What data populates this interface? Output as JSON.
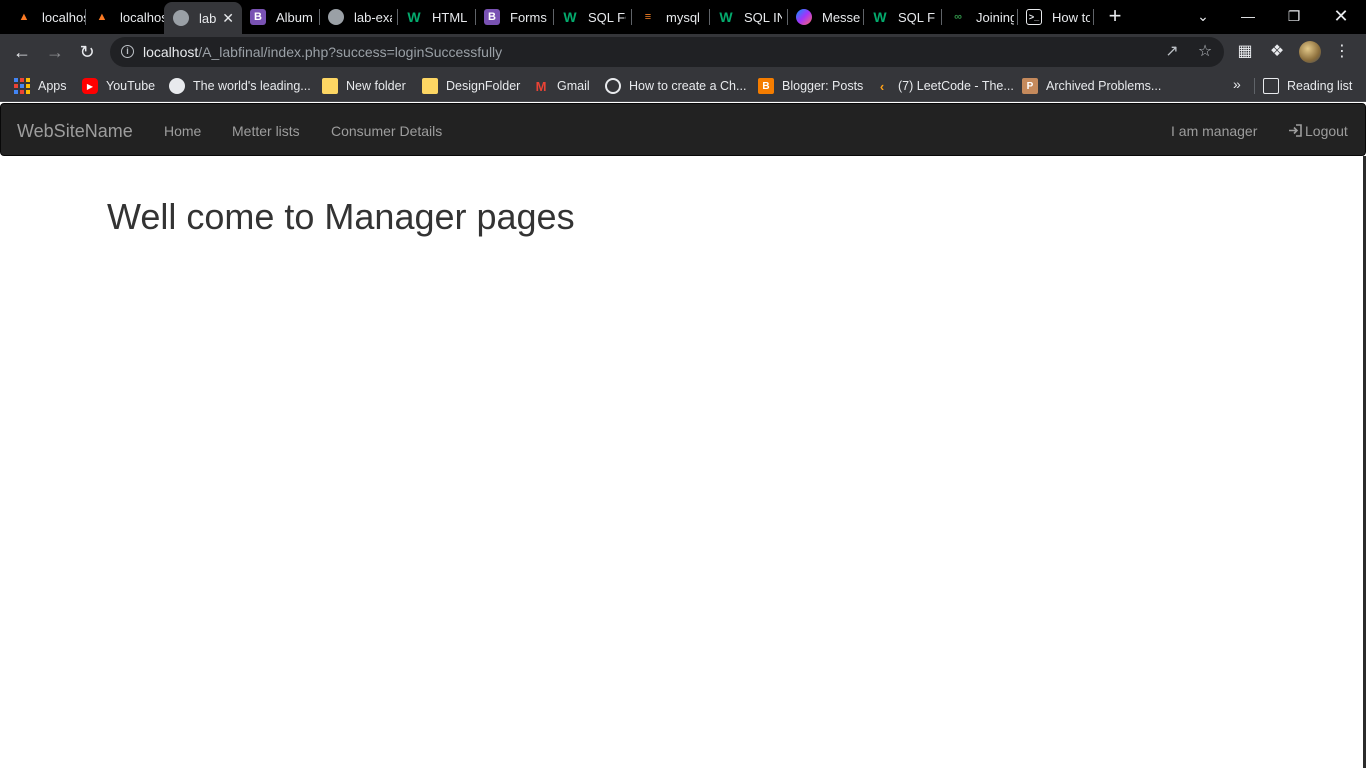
{
  "browser": {
    "tabs": [
      {
        "title": "localhost",
        "icon": "xampp-icon"
      },
      {
        "title": "localhost",
        "icon": "xampp-icon"
      },
      {
        "title": "lab",
        "icon": "globe-icon",
        "active": true
      },
      {
        "title": "Album",
        "icon": "bootstrap-icon"
      },
      {
        "title": "lab-exam",
        "icon": "globe-icon"
      },
      {
        "title": "HTML",
        "icon": "w3schools-icon"
      },
      {
        "title": "Forms",
        "icon": "bootstrap-icon"
      },
      {
        "title": "SQL FOREIGN",
        "icon": "w3schools-icon"
      },
      {
        "title": "mysql",
        "icon": "stackoverflow-icon"
      },
      {
        "title": "SQL INSERT",
        "icon": "w3schools-icon"
      },
      {
        "title": "Messenger",
        "icon": "messenger-icon"
      },
      {
        "title": "SQL FULL",
        "icon": "w3schools-icon"
      },
      {
        "title": "Joining",
        "icon": "geeksforgeeks-icon"
      },
      {
        "title": "How to",
        "icon": "page-icon"
      }
    ],
    "new_tab_symbol": "+",
    "close_symbol": "✕",
    "url_host": "localhost",
    "url_path": "/A_labfinal/index.php?success=loginSuccessfully",
    "bookmarks": [
      {
        "label": "Apps",
        "icon": "apps-grid-icon"
      },
      {
        "label": "YouTube",
        "icon": "youtube-icon"
      },
      {
        "label": "The world's leading...",
        "icon": "github-icon"
      },
      {
        "label": "New folder",
        "icon": "folder-icon"
      },
      {
        "label": "DesignFolder",
        "icon": "folder-icon"
      },
      {
        "label": "Gmail",
        "icon": "gmail-icon"
      },
      {
        "label": "How to create a Ch...",
        "icon": "chatgpt-icon"
      },
      {
        "label": "Blogger: Posts",
        "icon": "blogger-icon"
      },
      {
        "label": "(7) LeetCode - The...",
        "icon": "leetcode-icon"
      },
      {
        "label": "Archived Problems...",
        "icon": "archive-icon"
      }
    ],
    "bookmarks_overflow": "»",
    "reading_list": "Reading list"
  },
  "site": {
    "brand": "WebSiteName",
    "nav": [
      "Home",
      "Metter lists",
      "Consumer Details"
    ],
    "right_nav": {
      "user": "I am manager",
      "logout": "Logout"
    },
    "heading": "Well come to Manager pages"
  }
}
